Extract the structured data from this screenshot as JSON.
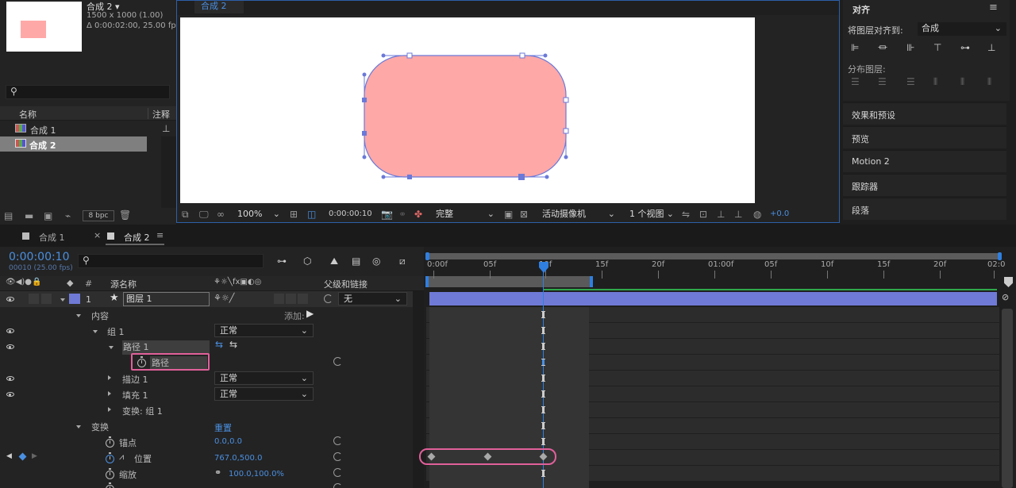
{
  "project": {
    "comp_name": "合成 2 ▾",
    "comp_size": "1500 x 1000 (1.00)",
    "comp_duration": "Δ 0:00:02:00, 25.00 fps",
    "search_placeholder": "",
    "col_name": "名称",
    "col_comment": "注释",
    "items": [
      "合成 1",
      "合成 2"
    ],
    "bpc": "8 bpc"
  },
  "viewer": {
    "tab": "合成 2",
    "zoom": "100%",
    "timecode": "0:00:00:10",
    "quality": "完整",
    "camera": "活动摄像机",
    "views": "1 个视图",
    "exposure": "+0.0",
    "shape_fill": "#ffa8a8"
  },
  "right_panel": {
    "align_title": "对齐",
    "align_to_label": "将图层对齐到:",
    "align_to_value": "合成",
    "distribute_label": "分布图层:",
    "sections": [
      "效果和预设",
      "预览",
      "Motion 2",
      "跟踪器",
      "段落"
    ]
  },
  "timeline": {
    "tabs": [
      "合成 1",
      "合成 2"
    ],
    "timecode": "0:00:00:10",
    "frame_info": "00010 (25.00 fps)",
    "col_hash": "#",
    "col_source": "源名称",
    "col_parent": "父级和链接",
    "layer_num": "1",
    "layer_name": "图层 1",
    "parent_value": "无",
    "rows": {
      "content": "内容",
      "add": "添加:",
      "group1": "组 1",
      "path1": "路径 1",
      "path": "路径",
      "stroke1": "描边 1",
      "fill1": "填充 1",
      "transform_group": "变换: 组 1",
      "transform": "变换",
      "reset": "重置",
      "anchor": "锚点",
      "anchor_value": "0.0,0.0",
      "position": "位置",
      "position_value": "767.0,500.0",
      "scale": "缩放",
      "scale_value": "100.0,100.0%",
      "mode_normal": "正常"
    },
    "ruler": [
      "0:00f",
      "05f",
      "10f",
      "15f",
      "20f",
      "01:00f",
      "05f",
      "10f",
      "15f",
      "20f",
      "02:0"
    ]
  }
}
